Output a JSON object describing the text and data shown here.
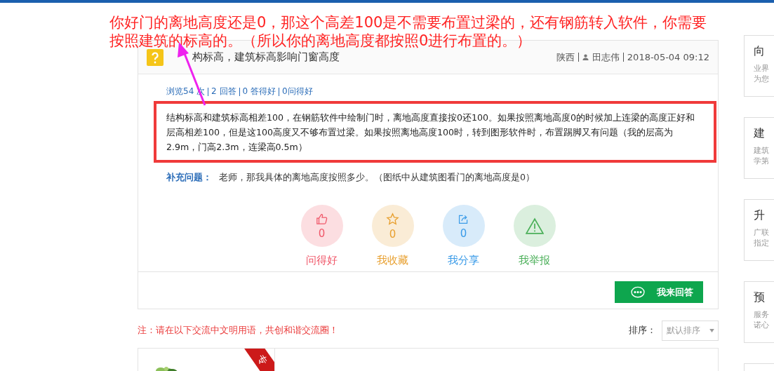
{
  "annotation": {
    "lines": [
      "你好门的离地高度还是0，那这个高差100是不需要布置过梁的，还有钢筋转入软件，你需要",
      "按照建筑的标高的。（所以你的离地高度都按照0进行布置的。）"
    ]
  },
  "question": {
    "title": "构标高，建筑标高影响门窗高度",
    "location": "陕西",
    "author": "田志伟",
    "date": "2018-05-04 09:12",
    "stats": [
      "浏览54 次",
      "2 回答",
      "0 答得好",
      "0问得好"
    ],
    "description": "结构标高和建筑标高相差100，在钢筋软件中绘制门时，离地高度直接按0还100。如果按照离地高度0的时候加上连梁的高度正好和层高相差100，但是这100高度又不够布置过梁。如果按照离地高度100时，转到图形软件时，布置踢脚又有问题（我的层高为2.9m，门高2.3m，连梁高0.5m）",
    "supplement_label": "补充问题：",
    "supplement_text": "老师，那我具体的离地高度按照多少。（图纸中从建筑图看门的离地高度是0）",
    "actions": [
      {
        "kind": "like",
        "count": "0",
        "label": "问得好",
        "color": "#f0586a"
      },
      {
        "kind": "favorite",
        "count": "0",
        "label": "我收藏",
        "color": "#e8a030"
      },
      {
        "kind": "share",
        "count": "0",
        "label": "我分享",
        "color": "#3a9be8"
      },
      {
        "kind": "report",
        "label": "我举报",
        "color": "#4cb05a"
      }
    ],
    "answer_button": "我来回答"
  },
  "notice": "注：请在以下交流中文明用语，共创和谐交流圈！",
  "sort": {
    "label": "排序：",
    "value": "默认排序"
  },
  "answer": {
    "badge": "专"
  },
  "sidebar": [
    {
      "title": "向",
      "lines": [
        "业界",
        "为您"
      ]
    },
    {
      "title": "建",
      "lines": [
        "建筑",
        "学第"
      ]
    },
    {
      "title": "升",
      "lines": [
        "广联",
        "指定"
      ]
    },
    {
      "title": "预",
      "lines": [
        "服务",
        "诺心"
      ]
    }
  ]
}
